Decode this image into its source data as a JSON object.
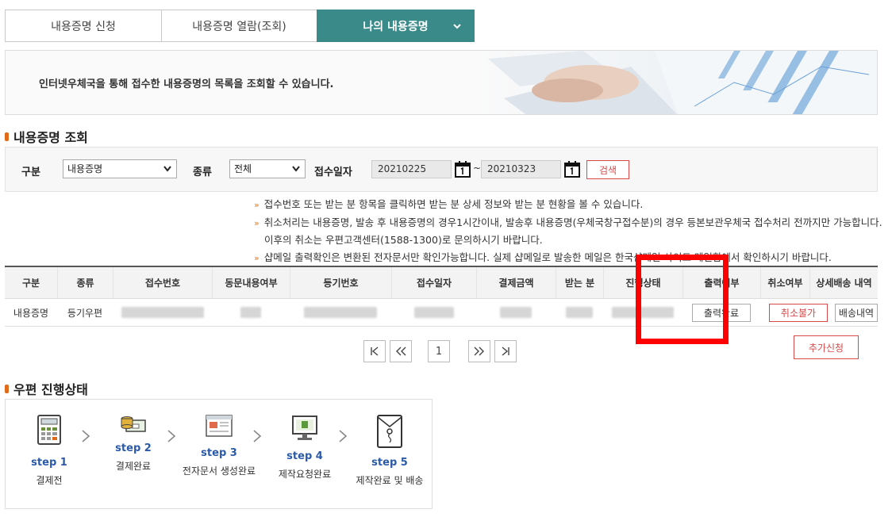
{
  "tabs": [
    {
      "label": "내용증명 신청"
    },
    {
      "label": "내용증명 열람(조회)"
    },
    {
      "label": "나의 내용증명"
    }
  ],
  "banner": {
    "text": "인터넷우체국을 통해 접수한 내용증명의 목록을 조회할 수 있습니다."
  },
  "search_section": {
    "title": "내용증명 조회",
    "category_label": "구분",
    "category_value": "내용증명",
    "type_label": "종류",
    "type_value": "전체",
    "date_label": "접수일자",
    "date_from": "20210225",
    "date_sep": "~",
    "date_to": "20210323",
    "search_button": "검색"
  },
  "notes": [
    "접수번호 또는 받는 분 항목을 클릭하면 받는 분 상세 정보와 받는 분 현황을 볼 수 있습니다.",
    "취소처리는 내용증명, 발송 후 내용증명의 경우1시간이내, 발송후 내용증명(우체국창구접수분)의 경우 등본보관우체국 접수처리 전까지만 가능합니다.",
    "이후의 취소는 우편고객센터(1588-1300)로 문의하시기 바랍니다.",
    "샵메일 출력확인은 변환된 전자문서만 확인가능합니다. 실제 샵메일로 발송한 메일은 한국샵메일 사이트 메일함에서 확인하시기 바랍니다."
  ],
  "table": {
    "headers": [
      "구분",
      "종류",
      "접수번호",
      "동문내용여부",
      "등기번호",
      "접수일자",
      "결제금액",
      "받는 분",
      "진행상태",
      "출력여부",
      "취소여부",
      "상세배송 내역"
    ],
    "row": {
      "category": "내용증명",
      "type": "등기우편",
      "print_button": "출력완료",
      "cancel_button": "취소불가",
      "delivery_button": "배송내역"
    }
  },
  "pager": {
    "first": "|<",
    "prev": "<<",
    "current": "1",
    "next": ">>",
    "last": ">|"
  },
  "add_button": "추가신청",
  "status_section": {
    "title": "우편 진행상태",
    "steps": [
      {
        "step": "step 1",
        "desc": "결제전",
        "icon": "calculator-icon"
      },
      {
        "step": "step 2",
        "desc": "결제완료",
        "icon": "money-icon"
      },
      {
        "step": "step 3",
        "desc": "전자문서 생성완료",
        "icon": "document-icon"
      },
      {
        "step": "step 4",
        "desc": "제작요청완료",
        "icon": "monitor-icon"
      },
      {
        "step": "step 5",
        "desc": "제작완료 및 배송",
        "icon": "envelope-icon"
      }
    ]
  },
  "colors": {
    "tab_active": "#3a8a8a",
    "accent_red": "#d84a4a",
    "step_blue": "#2a5aa8",
    "highlight": "#ff0000",
    "bullet_orange": "#e06a1a"
  }
}
